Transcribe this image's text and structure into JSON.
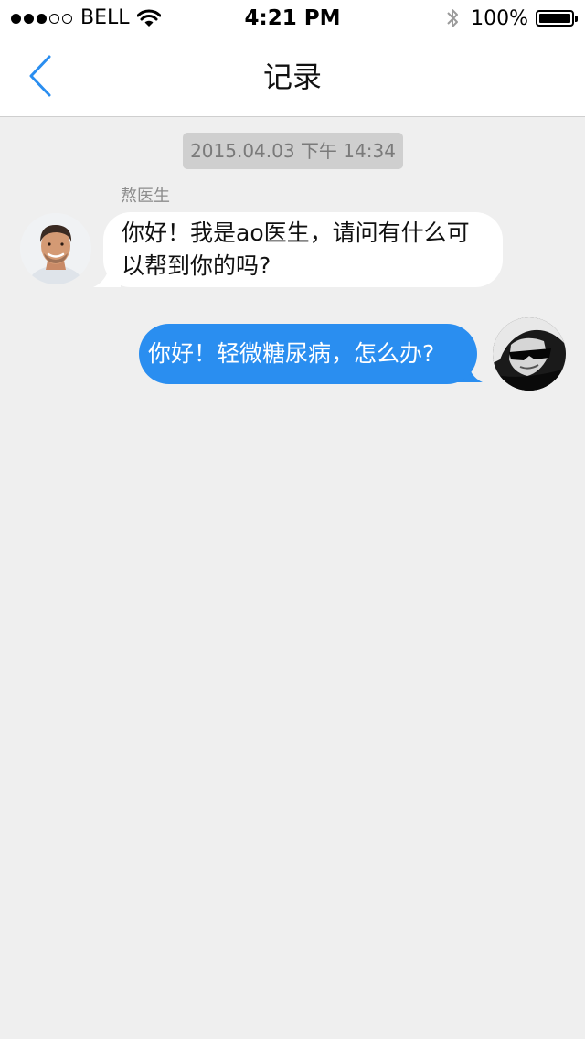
{
  "status_bar": {
    "carrier": "BELL",
    "time": "4:21 PM",
    "battery_percent": "100%",
    "signal_bars_filled": 3,
    "signal_bars_total": 5
  },
  "nav": {
    "title": "记录",
    "back_icon": "chevron-left-icon"
  },
  "chat": {
    "timestamp": "2015.04.03 下午 14:34",
    "messages": [
      {
        "from": "doctor",
        "sender_name": "熬医生",
        "text": "你好！我是ao医生，请问有什么可以帮到你的吗?"
      },
      {
        "from": "user",
        "text": "你好！轻微糖尿病，怎么办?"
      }
    ]
  },
  "colors": {
    "accent": "#2a8ef0",
    "background": "#efefef",
    "incoming_bubble": "#ffffff",
    "timestamp_bg": "#cfcfcf"
  }
}
